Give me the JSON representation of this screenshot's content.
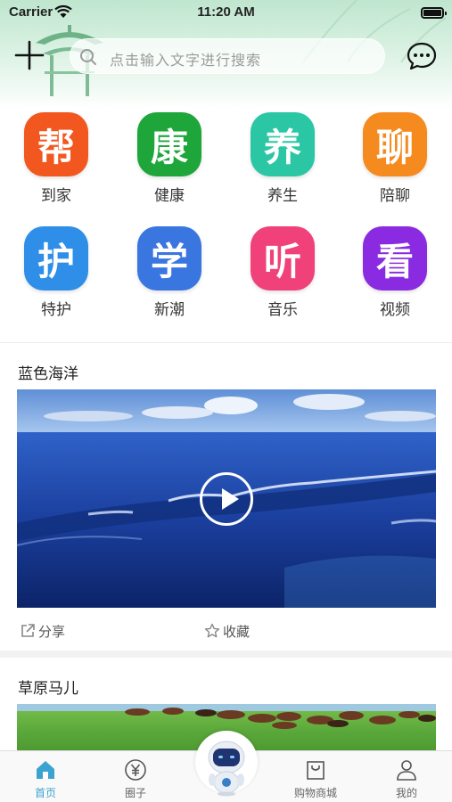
{
  "status_bar": {
    "carrier": "Carrier",
    "time": "11:20 AM"
  },
  "search": {
    "placeholder": "点击输入文字进行搜索"
  },
  "services": [
    {
      "char": "帮",
      "label": "到家",
      "color": "#f2571f"
    },
    {
      "char": "康",
      "label": "健康",
      "color": "#1ea63a"
    },
    {
      "char": "养",
      "label": "养生",
      "color": "#2bc7a4"
    },
    {
      "char": "聊",
      "label": "陪聊",
      "color": "#f58a1f"
    },
    {
      "char": "护",
      "label": "特护",
      "color": "#2f8fe8"
    },
    {
      "char": "学",
      "label": "新潮",
      "color": "#3a76e0"
    },
    {
      "char": "听",
      "label": "音乐",
      "color": "#f0417a"
    },
    {
      "char": "看",
      "label": "视频",
      "color": "#8a2be2"
    }
  ],
  "posts": [
    {
      "title": "蓝色海洋",
      "share": "分享",
      "favorite": "收藏"
    },
    {
      "title": "草原马儿"
    }
  ],
  "tabbar": [
    {
      "label": "首页",
      "icon": "home-icon",
      "active": true
    },
    {
      "label": "圈子",
      "icon": "yen-circle-icon"
    },
    {
      "label": "购物商城",
      "icon": "shopping-bag-icon"
    },
    {
      "label": "我的",
      "icon": "person-icon"
    }
  ],
  "colors": {
    "accent": "#3aa3d0",
    "header_green": "#bfe6cf"
  }
}
